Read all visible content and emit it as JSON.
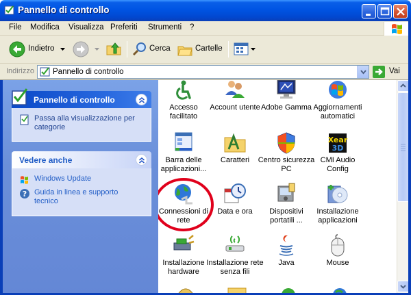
{
  "window": {
    "title": "Pannello di controllo"
  },
  "menu": [
    "File",
    "Modifica",
    "Visualizza",
    "Preferiti",
    "Strumenti",
    "?"
  ],
  "toolbar": {
    "back_label": "Indietro",
    "search_label": "Cerca",
    "folders_label": "Cartelle"
  },
  "address": {
    "label": "Indirizzo",
    "value": "Pannello di controllo",
    "go_label": "Vai"
  },
  "sidebar": {
    "panel_title": "Pannello di controllo",
    "switch_view": "Passa alla visualizzazione per categorie",
    "see_also_title": "Vedere anche",
    "see_also": [
      "Windows Update",
      "Guida in linea e supporto tecnico"
    ]
  },
  "items": [
    {
      "label": "Accesso facilitato",
      "icon": "accessibility-icon"
    },
    {
      "label": "Account utente",
      "icon": "user-accounts-icon"
    },
    {
      "label": "Adobe Gamma",
      "icon": "monitor-icon"
    },
    {
      "label": "Aggiornamenti automatici",
      "icon": "windows-update-icon"
    },
    {
      "label": "Barra delle applicazioni...",
      "icon": "taskbar-icon"
    },
    {
      "label": "Caratteri",
      "icon": "fonts-folder-icon"
    },
    {
      "label": "Centro sicurezza PC",
      "icon": "security-shield-icon"
    },
    {
      "label": "CMI Audio Config",
      "icon": "cmi-audio-icon"
    },
    {
      "label": "Connessioni di rete",
      "icon": "network-connections-icon"
    },
    {
      "label": "Data e ora",
      "icon": "date-time-icon"
    },
    {
      "label": "Dispositivi portatili ...",
      "icon": "portable-devices-icon"
    },
    {
      "label": "Installazione applicazioni",
      "icon": "add-remove-programs-icon"
    },
    {
      "label": "Installazione hardware",
      "icon": "add-hardware-icon"
    },
    {
      "label": "Installazione rete senza fili",
      "icon": "wireless-network-icon"
    },
    {
      "label": "Java",
      "icon": "java-icon"
    },
    {
      "label": "Mouse",
      "icon": "mouse-icon"
    }
  ],
  "colors": {
    "titlebar": "#0054e3",
    "taskpane": "#7ba2e7",
    "link": "#215dc6",
    "highlight": "#e0001b"
  }
}
